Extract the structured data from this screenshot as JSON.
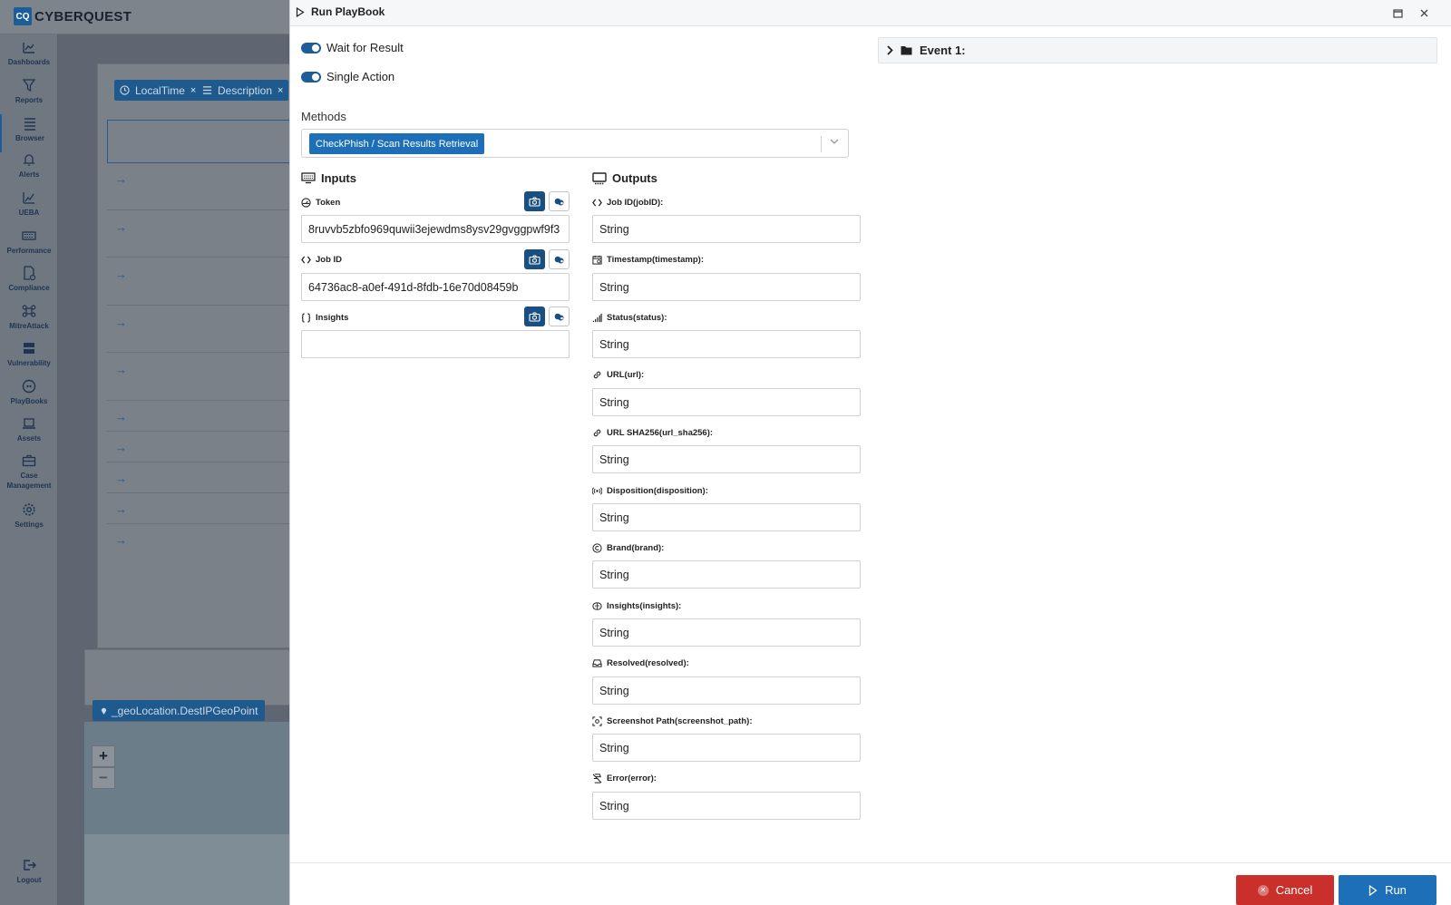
{
  "app": {
    "logo_badge": "CQ",
    "logo_text": "CYBERQUEST"
  },
  "sidebar": {
    "items": [
      {
        "label": "Dashboards",
        "icon": "dashboard-icon"
      },
      {
        "label": "Reports",
        "icon": "filter-icon"
      },
      {
        "label": "Browser",
        "icon": "list-icon"
      },
      {
        "label": "Alerts",
        "icon": "bell-icon"
      },
      {
        "label": "UEBA",
        "icon": "chart-icon"
      },
      {
        "label": "Performance",
        "icon": "keyboard-icon"
      },
      {
        "label": "Compliance",
        "icon": "document-check-icon"
      },
      {
        "label": "MitreAttack",
        "icon": "command-icon"
      },
      {
        "label": "Vulnerability",
        "icon": "server-icon"
      },
      {
        "label": "PlayBooks",
        "icon": "playbook-icon"
      },
      {
        "label": "Assets",
        "icon": "laptop-icon"
      },
      {
        "label": "Case Management",
        "icon": "briefcase-icon"
      },
      {
        "label": "Settings",
        "icon": "gear-icon"
      },
      {
        "label": "Logout",
        "icon": "logout-icon"
      }
    ]
  },
  "background": {
    "tags": [
      {
        "label": "LocalTime",
        "close": "×"
      },
      {
        "label": "Description",
        "close": "×"
      }
    ],
    "geo_tag": "_geoLocation.DestIPGeoPoint",
    "zoom_in": "+",
    "zoom_out": "−"
  },
  "modal": {
    "title": "Run PlayBook",
    "toggles": {
      "wait_for_result": "Wait for Result",
      "single_action": "Single Action"
    },
    "methods": {
      "label": "Methods",
      "selected": "CheckPhish / Scan Results Retrieval"
    },
    "inputs": {
      "title": "Inputs",
      "fields": [
        {
          "label": "Token",
          "value": "8ruvvb5zbfo969quwii3ejewdms8ysv29gvggpwf9f3"
        },
        {
          "label": "Job ID",
          "value": "64736ac8-a0ef-491d-8fdb-16e70d08459b"
        },
        {
          "label": "Insights",
          "value": ""
        }
      ]
    },
    "outputs": {
      "title": "Outputs",
      "fields": [
        {
          "label": "Job ID(jobID):",
          "value": "String"
        },
        {
          "label": "Timestamp(timestamp):",
          "value": "String"
        },
        {
          "label": "Status(status):",
          "value": "String"
        },
        {
          "label": "URL(url):",
          "value": "String"
        },
        {
          "label": "URL SHA256(url_sha256):",
          "value": "String"
        },
        {
          "label": "Disposition(disposition):",
          "value": "String"
        },
        {
          "label": "Brand(brand):",
          "value": "String"
        },
        {
          "label": "Insights(insights):",
          "value": "String"
        },
        {
          "label": "Resolved(resolved):",
          "value": "String"
        },
        {
          "label": "Screenshot Path(screenshot_path):",
          "value": "String"
        },
        {
          "label": "Error(error):",
          "value": "String"
        }
      ]
    },
    "event": {
      "label": "Event 1:"
    },
    "buttons": {
      "cancel": "Cancel",
      "run": "Run"
    }
  },
  "colors": {
    "accent": "#1d6fb8",
    "accent_dark": "#1a4f82",
    "danger": "#c9302c"
  }
}
